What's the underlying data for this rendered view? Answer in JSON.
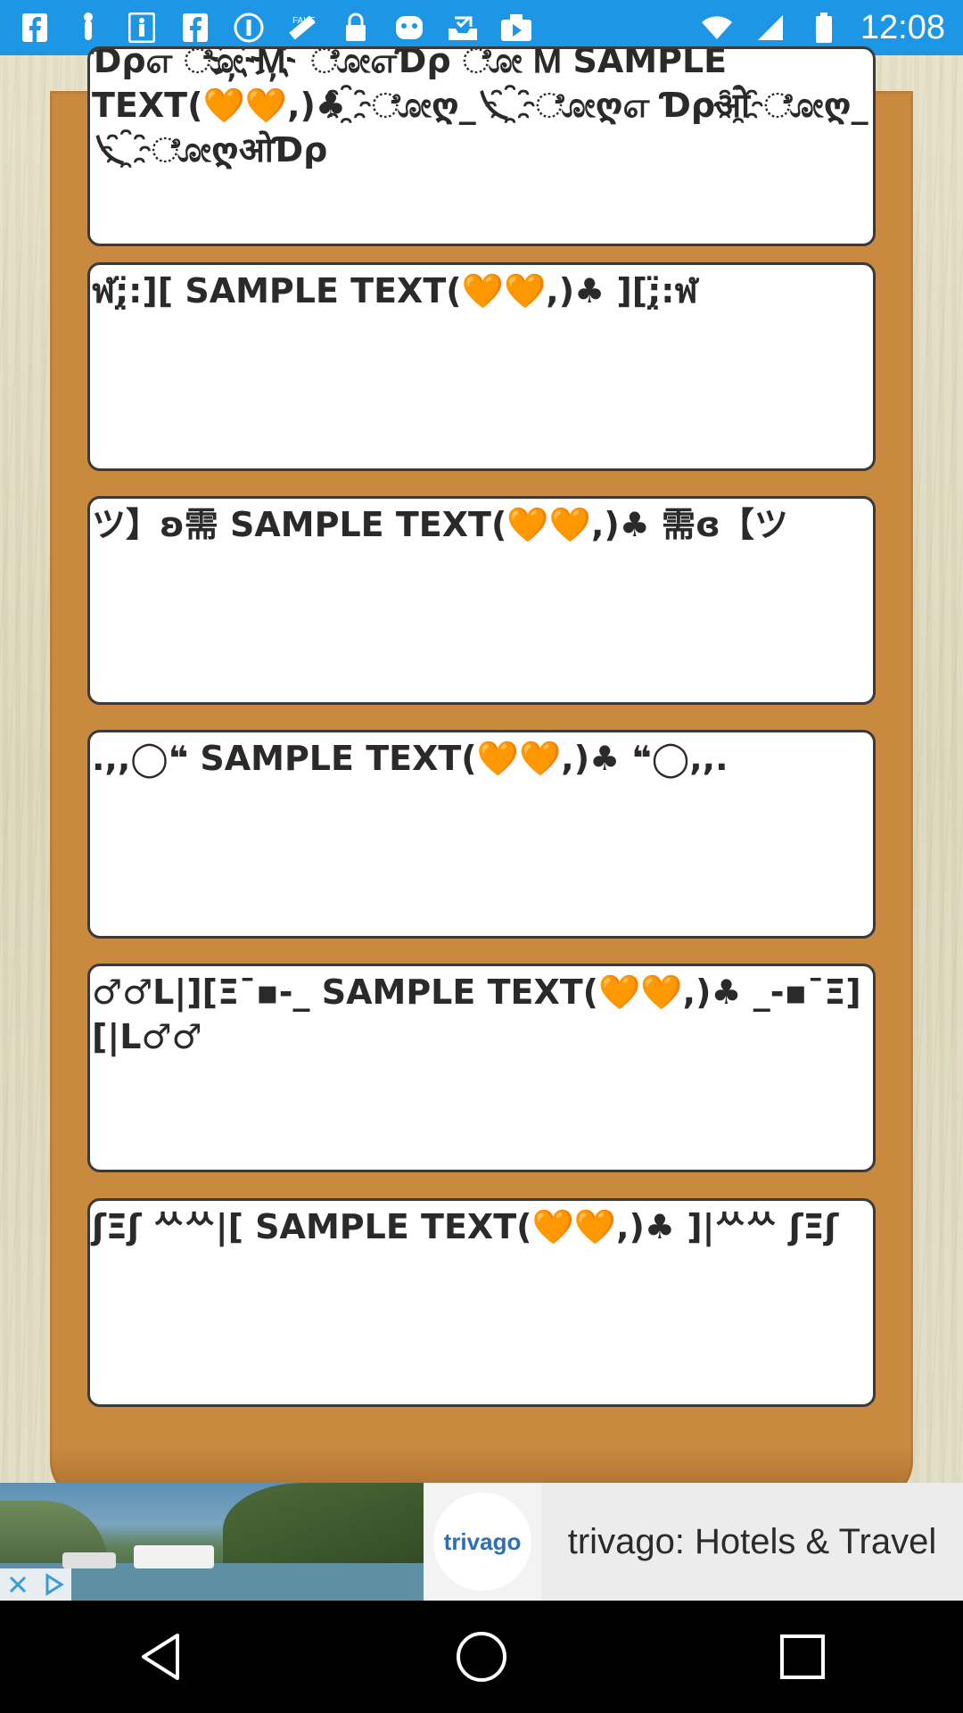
{
  "status_bar": {
    "time": "12:08",
    "icons": [
      "facebook-icon",
      "touch-icon",
      "accessibility-icon",
      "facebook-icon",
      "info-icon",
      "satellite-icon",
      "lock-icon",
      "emoji-icon",
      "checkmark-tray-icon",
      "video-icon"
    ],
    "fake_label": "FAKE"
  },
  "cards": [
    {
      "text": "Ɗρஎ ೋ҉Ꮇ҉ ೋஎƊρ ೋ Ꮇ SAMPLE TEXT(🧡🧡,)♣ ҈ೋღ_乀 ҈ೋღஎ Ɗρओ҈ೋღ_乀 ҈ೋღओƊρ"
    },
    {
      "text": "ฬ;̤̈:][ SAMPLE TEXT(🧡🧡,)♣ ][;̤̈:ฬ"
    },
    {
      "text": "ツ】ʚ需 SAMPLE TEXT(🧡🧡,)♣ 需ɞ【ツ"
    },
    {
      "text": ".,,◯❝ SAMPLE TEXT(🧡🧡,)♣ ❝◯,,."
    },
    {
      "text": "♂♂L|][Ξ¯▪-_ SAMPLE TEXT(🧡🧡,)♣ _-▪¯Ξ][|L♂♂"
    },
    {
      "text": "ʃΞʃ ᄊᄊ|[ SAMPLE TEXT(🧡🧡,)♣ ]|ᄊᄊ ʃΞʃ"
    }
  ],
  "ad": {
    "title": "trivago: Hotels & Travel",
    "logo_text": "trivago"
  },
  "colors": {
    "status_bar": "#1d96e6",
    "board": "#c9893f",
    "card_border": "#3a3a3a"
  }
}
